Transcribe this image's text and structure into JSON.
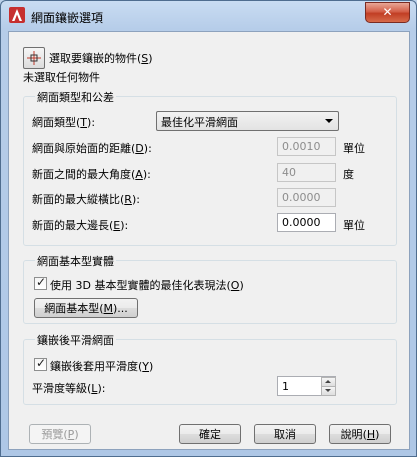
{
  "window": {
    "title": "網面鑲嵌選項",
    "close_glyph": "✕"
  },
  "selection": {
    "pick_label": "選取要鑲嵌的物件",
    "pick_key": "S",
    "status": "未選取任何物件"
  },
  "mesh_type_group": {
    "title": "網面類型和公差",
    "mesh_type_label": "網面類型",
    "mesh_type_key": "T",
    "mesh_type_value": "最佳化平滑網面",
    "distance_label": "網面與原始面的距離",
    "distance_key": "D",
    "distance_value": "0.0010",
    "distance_unit": "單位",
    "angle_label": "新面之間的最大角度",
    "angle_key": "A",
    "angle_value": "40",
    "angle_unit": "度",
    "aspect_label": "新面的最大縱橫比",
    "aspect_key": "R",
    "aspect_value": "0.0000",
    "edge_label": "新面的最大邊長",
    "edge_key": "E",
    "edge_value": "0.0000",
    "edge_unit": "單位"
  },
  "primitive_group": {
    "title": "網面基本型實體",
    "checkbox_label": "使用 3D 基本型實體的最佳化表現法",
    "checkbox_key": "O",
    "checkbox_checked": true,
    "button_label": "網面基本型",
    "button_key": "M",
    "button_suffix": "..."
  },
  "smooth_group": {
    "title": "鑲嵌後平滑網面",
    "checkbox_label": "鑲嵌後套用平滑度",
    "checkbox_key": "Y",
    "checkbox_checked": true,
    "level_label": "平滑度等級",
    "level_key": "L",
    "level_value": "1"
  },
  "footer": {
    "preview_label": "預覽",
    "preview_key": "P",
    "ok_label": "確定",
    "cancel_label": "取消",
    "help_label": "說明",
    "help_key": "H"
  },
  "colors": {
    "accent": "#c0392b",
    "title_bg": "#b6cde9"
  }
}
